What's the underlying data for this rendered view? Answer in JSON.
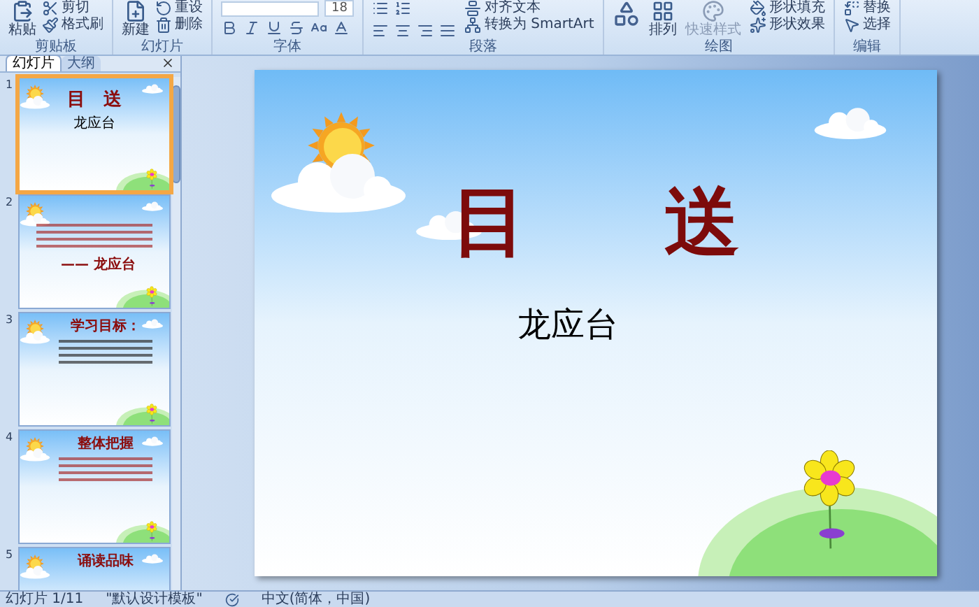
{
  "ribbon": {
    "groups": [
      {
        "label": "剪贴板",
        "large": {
          "label": "粘贴"
        },
        "small": [
          {
            "label": "剪切"
          },
          {
            "label": "格式刷"
          }
        ]
      },
      {
        "label": "幻灯片",
        "large": {
          "label": "新建"
        },
        "small": [
          {
            "label": "重设"
          },
          {
            "label": "删除"
          }
        ]
      },
      {
        "label": "字体",
        "kind": "font",
        "font_size": "18"
      },
      {
        "label": "段落",
        "kind": "paragraph",
        "small": [
          {
            "label": "对齐文本"
          },
          {
            "label": "转换为 SmartArt"
          }
        ]
      },
      {
        "label": "绘图",
        "kind": "drawing",
        "large": {
          "label": "排列"
        },
        "quick": "快速样式",
        "small": [
          {
            "label": "形状填充"
          },
          {
            "label": "形状效果"
          }
        ]
      },
      {
        "label": "编辑",
        "kind": "editing",
        "small": [
          {
            "label": "替换"
          },
          {
            "label": "选择"
          }
        ]
      }
    ]
  },
  "panel": {
    "tabs": [
      {
        "label": "幻灯片",
        "selected": true
      },
      {
        "label": "大纲",
        "selected": false
      }
    ],
    "slides": [
      {
        "number": "1",
        "kind": "cover",
        "selected": true,
        "title": "目　送",
        "subtitle": "龙应台"
      },
      {
        "number": "2",
        "kind": "quote",
        "selected": false,
        "subtitle": "—— 龙应台"
      },
      {
        "number": "3",
        "kind": "objectives",
        "selected": false,
        "title": "学习目标："
      },
      {
        "number": "4",
        "kind": "overview",
        "selected": false,
        "title": "整体把握"
      },
      {
        "number": "5",
        "kind": "section",
        "selected": false,
        "title": "诵读品味"
      }
    ]
  },
  "slide": {
    "title_left": "目",
    "title_right": "送",
    "author": "龙应台"
  },
  "status_bar": {
    "slide": "幻灯片 1/11",
    "theme": "\"默认设计模板\"",
    "language": "中文(简体，中国)"
  }
}
